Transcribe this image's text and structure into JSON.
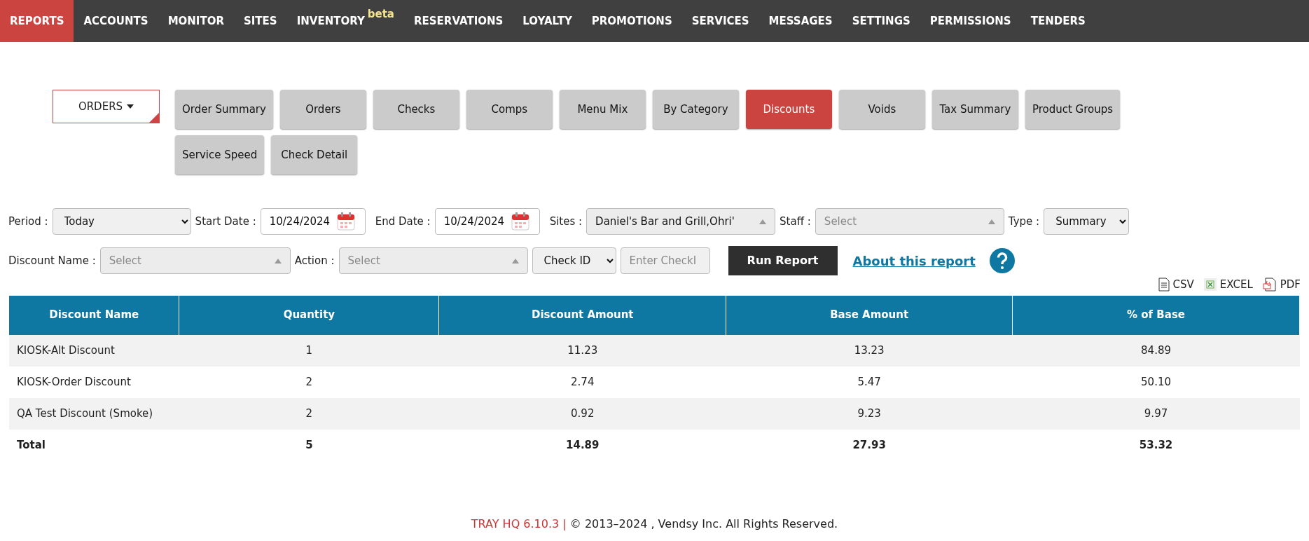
{
  "nav": [
    {
      "label": "REPORTS",
      "selected": true
    },
    {
      "label": "ACCOUNTS",
      "selected": false
    },
    {
      "label": "MONITOR",
      "selected": false
    },
    {
      "label": "SITES",
      "selected": false
    },
    {
      "label": "INVENTORY",
      "selected": false,
      "badge": "beta"
    },
    {
      "label": "RESERVATIONS",
      "selected": false
    },
    {
      "label": "LOYALTY",
      "selected": false
    },
    {
      "label": "PROMOTIONS",
      "selected": false
    },
    {
      "label": "SERVICES",
      "selected": false
    },
    {
      "label": "MESSAGES",
      "selected": false
    },
    {
      "label": "SETTINGS",
      "selected": false
    },
    {
      "label": "PERMISSIONS",
      "selected": false
    },
    {
      "label": "TENDERS",
      "selected": false
    }
  ],
  "report_menu": {
    "label": "ORDERS"
  },
  "report_tabs": [
    {
      "label": "Order Summary",
      "selected": false
    },
    {
      "label": "Orders",
      "selected": false
    },
    {
      "label": "Checks",
      "selected": false
    },
    {
      "label": "Comps",
      "selected": false
    },
    {
      "label": "Menu Mix",
      "selected": false
    },
    {
      "label": "By Category",
      "selected": false
    },
    {
      "label": "Discounts",
      "selected": true
    },
    {
      "label": "Voids",
      "selected": false
    },
    {
      "label": "Tax Summary",
      "selected": false
    },
    {
      "label": "Product Groups",
      "selected": false
    },
    {
      "label": "Service Speed",
      "selected": false
    },
    {
      "label": "Check Detail",
      "selected": false
    }
  ],
  "filters": [
    [
      {
        "kind": "select",
        "label": "Period :",
        "value": "Today"
      },
      {
        "kind": "date",
        "label": "Start Date :",
        "value": "10/24/2024"
      },
      {
        "kind": "date",
        "label": "End Date :",
        "value": "10/24/2024"
      },
      {
        "kind": "multi",
        "label": "Sites :",
        "value": "Daniel's Bar and Grill,Ohri'"
      },
      {
        "kind": "multi",
        "label": "Staff :",
        "placeholder": "Select"
      },
      {
        "kind": "select",
        "label": "Type :",
        "value": "Summary"
      }
    ],
    [
      {
        "kind": "multi",
        "label": "Discount Name :",
        "placeholder": "Select"
      },
      {
        "kind": "multi",
        "label": "Action :",
        "placeholder": "Select"
      },
      {
        "kind": "select",
        "value": "Check ID"
      },
      {
        "kind": "text",
        "placeholder": "Enter CheckI"
      }
    ]
  ],
  "run_button": "Run Report",
  "about_link": "About this report",
  "exports": [
    {
      "kind": "csv",
      "label": "CSV"
    },
    {
      "kind": "excel",
      "label": "EXCEL"
    },
    {
      "kind": "pdf",
      "label": "PDF"
    }
  ],
  "table": {
    "columns": [
      "Discount Name",
      "Quantity",
      "Discount Amount",
      "Base Amount",
      "% of Base"
    ],
    "rows": [
      [
        "KIOSK-Alt Discount",
        "1",
        "11.23",
        "13.23",
        "84.89"
      ],
      [
        "KIOSK-Order Discount",
        "2",
        "2.74",
        "5.47",
        "50.10"
      ],
      [
        "QA Test Discount (Smoke)",
        "2",
        "0.92",
        "9.23",
        "9.97"
      ]
    ],
    "total": [
      "Total",
      "5",
      "14.89",
      "27.93",
      "53.32"
    ]
  },
  "footer": {
    "version": "TRAY HQ 6.10.3 |",
    "copyright": "© 2013–2024 , Vendsy Inc. All Rights Reserved."
  }
}
